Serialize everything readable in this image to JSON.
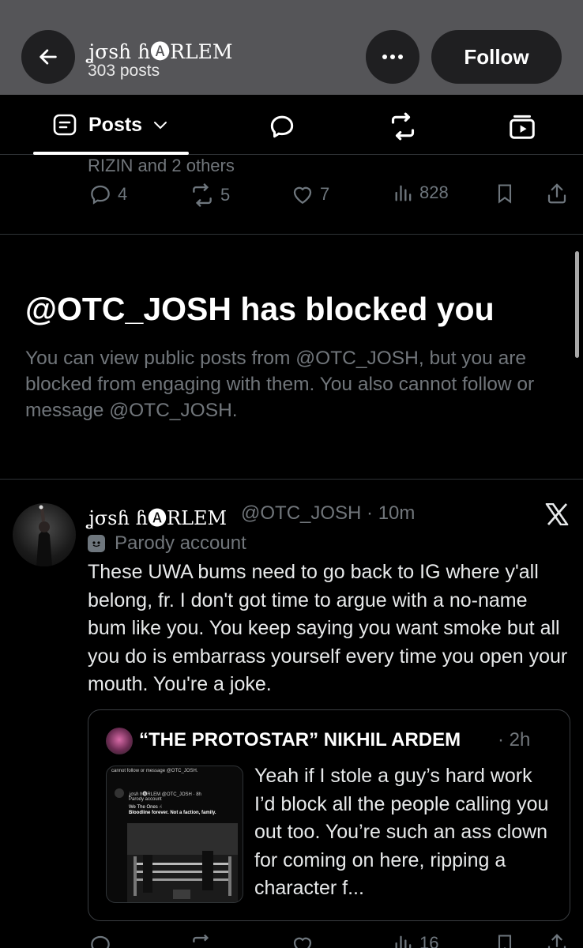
{
  "header": {
    "display_name": "ʝσѕɦ ɦ🅐RLEM",
    "post_count": "303 posts",
    "follow_label": "Follow"
  },
  "tabs": [
    {
      "label": "Posts",
      "icon": "posts-icon",
      "active": true
    },
    {
      "label": "",
      "icon": "reply-bubble-icon"
    },
    {
      "label": "",
      "icon": "repost-icon"
    },
    {
      "label": "",
      "icon": "media-icon"
    }
  ],
  "prev_post": {
    "context": "RIZIN and 2 others",
    "replies": "4",
    "reposts": "5",
    "likes": "7",
    "views": "828"
  },
  "blocked": {
    "title": "@OTC_JOSH has blocked you",
    "body": "You can view public posts from @OTC_JOSH, but you are blocked from engaging with them. You also cannot follow or message @OTC_JOSH."
  },
  "tweet": {
    "display_name": "ʝσѕɦ ɦ🅐RLEM",
    "handle_time": "@OTC_JOSH · 10m",
    "label": "Parody account",
    "text": "These UWA bums need to go back to IG where y'all belong, fr. I don't got time to argue with a no-name bum like you. You keep saying you want smoke but all you do is embarrass yourself every time you open your mouth. You're a joke.",
    "quote": {
      "name": "“THE PROTOSTAR” NIKHIL ARDEM",
      "time": "· 2h",
      "text": "Yeah if I stole a guy’s hard work I’d block all the people calling you out too. You’re such an ass clown for coming on here, ripping a character f...",
      "thumb": {
        "top_line": "cannot follow or message @OTC_JOSH.",
        "name": "ʝσѕɦ ɦ🅐RLEM @OTC_JOSH · 8h",
        "label": "Parody account",
        "line1": "We The Ones ☝",
        "line2": "Bloodline forever. Not a faction, family."
      }
    },
    "views": "16"
  },
  "colors": {
    "header_bg": "#555558",
    "muted": "#71767b",
    "separator": "#2f3336"
  }
}
